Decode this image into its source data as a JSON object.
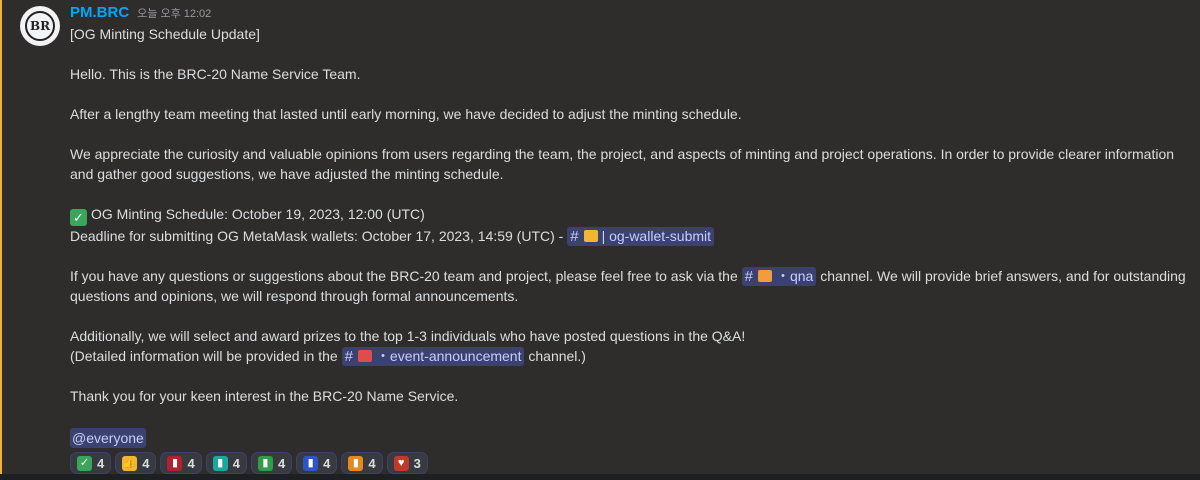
{
  "message": {
    "username": "PM.BRC",
    "timestamp": "오늘 오후 12:02",
    "avatar_text": "BR",
    "lines": {
      "title": "[OG Minting Schedule Update]",
      "hello": "Hello. This is the BRC-20 Name Service Team.",
      "meeting": "After a lengthy team meeting that lasted until early morning, we have decided to adjust the minting schedule.",
      "appreciate_1": "We appreciate the curiosity and valuable opinions from users regarding the team, the project, and aspects of minting and project operations. In order to provide clearer information",
      "appreciate_2": "and gather good suggestions, we have adjusted the minting schedule.",
      "schedule": "OG Minting Schedule: October 19, 2023, 12:00 (UTC)",
      "deadline": "Deadline for submitting OG MetaMask wallets: October 17, 2023, 14:59 (UTC) -",
      "questions_pre": "If you have any questions or suggestions about the BRC-20 team and project, please feel free to ask via the",
      "questions_post": "channel. We will provide brief answers, and for outstanding",
      "questions_2": "questions and opinions, we will respond through formal announcements.",
      "additionally": "Additionally, we will select and award prizes to the top 1-3 individuals who have posted questions in the Q&A!",
      "detailed_pre": "(Detailed information will be provided in the",
      "detailed_post": "channel.)",
      "thanks": "Thank you for your keen interest in the BRC-20 Name Service.",
      "everyone": "@everyone"
    },
    "channels": {
      "og_wallet": "| og-wallet-submit",
      "qna": "・qna",
      "event": "・event-announcement",
      "hash": "#"
    },
    "reactions": [
      {
        "icon": "check-mark-icon",
        "color": "#3ba55c",
        "glyph": "✓",
        "count": "4"
      },
      {
        "icon": "thumbs-up-icon",
        "color": "#f2b632",
        "glyph": "👍",
        "count": "4"
      },
      {
        "icon": "custom-red-emoji-icon",
        "color": "#b3202f",
        "glyph": "▮",
        "count": "4"
      },
      {
        "icon": "custom-teal-emoji-icon",
        "color": "#1aa9a0",
        "glyph": "▮",
        "count": "4"
      },
      {
        "icon": "custom-green-emoji-icon",
        "color": "#2f9e44",
        "glyph": "▮",
        "count": "4"
      },
      {
        "icon": "custom-blue-emoji-icon",
        "color": "#2b55c9",
        "glyph": "▮",
        "count": "4"
      },
      {
        "icon": "custom-orange-emoji-icon",
        "color": "#e6891e",
        "glyph": "▮",
        "count": "4"
      },
      {
        "icon": "heart-eyes-icon",
        "color": "#c0392b",
        "glyph": "♥",
        "count": "3"
      }
    ]
  },
  "colors": {
    "username": "#00a8fc",
    "mention_bar": "#f0b232",
    "channel_bg": "#3c4270"
  }
}
